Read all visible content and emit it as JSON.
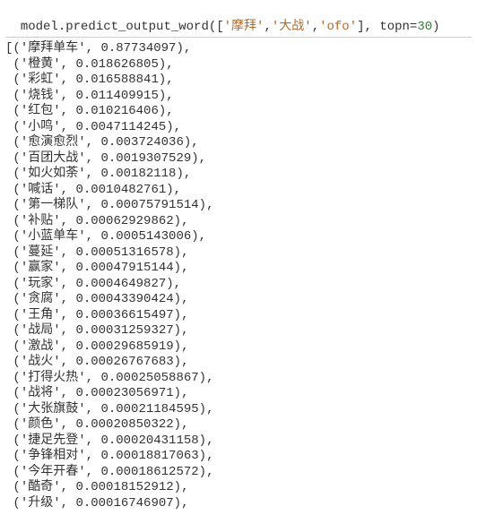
{
  "input": {
    "prefix": "model.predict_output_word(",
    "list_open": "[",
    "args": [
      "'摩拜'",
      "'大战'",
      "'ofo'"
    ],
    "list_sep": ",",
    "list_close": "]",
    "after_list": ", topn=",
    "topn": "30",
    "suffix": ")"
  },
  "output": {
    "open": "[",
    "item_open": "(",
    "item_sep": ", ",
    "item_close": ")",
    "line_trail": ",",
    "indent": " ",
    "last_close": "",
    "rows": [
      {
        "word": "'摩拜单车'",
        "score": "0.87734097"
      },
      {
        "word": "'橙黄'",
        "score": "0.018626805"
      },
      {
        "word": "'彩虹'",
        "score": "0.016588841"
      },
      {
        "word": "'烧钱'",
        "score": "0.011409915"
      },
      {
        "word": "'红包'",
        "score": "0.010216406"
      },
      {
        "word": "'小鸣'",
        "score": "0.0047114245"
      },
      {
        "word": "'愈演愈烈'",
        "score": "0.003724036"
      },
      {
        "word": "'百团大战'",
        "score": "0.0019307529"
      },
      {
        "word": "'如火如荼'",
        "score": "0.00182118"
      },
      {
        "word": "'喊话'",
        "score": "0.0010482761"
      },
      {
        "word": "'第一梯队'",
        "score": "0.00075791514"
      },
      {
        "word": "'补贴'",
        "score": "0.00062929862"
      },
      {
        "word": "'小蓝单车'",
        "score": "0.0005143006"
      },
      {
        "word": "'蔓延'",
        "score": "0.00051316578"
      },
      {
        "word": "'赢家'",
        "score": "0.00047915144"
      },
      {
        "word": "'玩家'",
        "score": "0.0004649827"
      },
      {
        "word": "'贪腐'",
        "score": "0.00043390424"
      },
      {
        "word": "'王角'",
        "score": "0.00036615497"
      },
      {
        "word": "'战局'",
        "score": "0.00031259327"
      },
      {
        "word": "'激战'",
        "score": "0.00029685919"
      },
      {
        "word": "'战火'",
        "score": "0.00026767683"
      },
      {
        "word": "'打得火热'",
        "score": "0.00025058867"
      },
      {
        "word": "'战将'",
        "score": "0.00023056971"
      },
      {
        "word": "'大张旗鼓'",
        "score": "0.00021184595"
      },
      {
        "word": "'颜色'",
        "score": "0.00020850322"
      },
      {
        "word": "'捷足先登'",
        "score": "0.00020431158"
      },
      {
        "word": "'争锋相对'",
        "score": "0.00018817063"
      },
      {
        "word": "'今年开春'",
        "score": "0.00018612572"
      },
      {
        "word": "'酷奇'",
        "score": "0.00018152912"
      },
      {
        "word": "'升级'",
        "score": "0.00016746907"
      }
    ]
  }
}
